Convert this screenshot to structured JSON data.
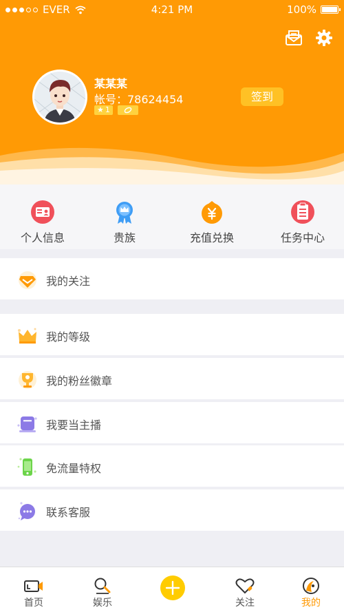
{
  "status_bar": {
    "carrier": "EVER",
    "time": "4:21 PM",
    "battery": "100%"
  },
  "profile": {
    "name": "某某某",
    "account": "帐号：78624454",
    "level_badge": "1",
    "checkin_label": "签到"
  },
  "quick_menu": [
    {
      "label": "个人信息",
      "icon": "id-card-icon",
      "color": "#f0505a"
    },
    {
      "label": "贵族",
      "icon": "crown-medal-icon",
      "color": "#3f9df5"
    },
    {
      "label": "充值兑换",
      "icon": "yen-coin-icon",
      "color": "#ff9a05"
    },
    {
      "label": "任务中心",
      "icon": "task-list-icon",
      "color": "#f0505a"
    }
  ],
  "list": {
    "follow": "我的关注",
    "level": "我的等级",
    "fan_badge": "我的粉丝徽章",
    "anchor": "我要当主播",
    "free_data": "免流量特权",
    "support": "联系客服"
  },
  "tabbar": [
    {
      "label": "首页",
      "icon": "camera-icon"
    },
    {
      "label": "娱乐",
      "icon": "search-icon"
    },
    {
      "label": "关注",
      "icon": "heart-icon"
    },
    {
      "label": "我的",
      "icon": "profile-icon"
    }
  ],
  "colors": {
    "brand": "#ff9a05",
    "checkin_bg": "#ffc125",
    "plus_button": "#ffcc00",
    "active_tab": "#ff9a05"
  }
}
